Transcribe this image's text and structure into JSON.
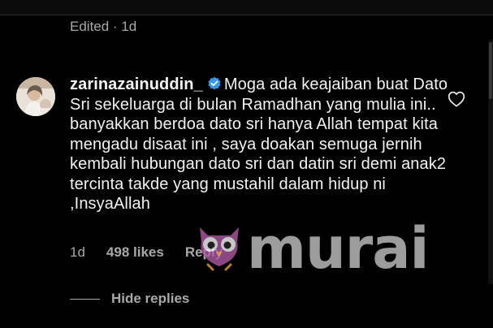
{
  "previous_comment": {
    "meta": "Edited · 1d"
  },
  "comment": {
    "username": "zarinazainuddin_",
    "verified_icon": "verified-badge-icon",
    "text": "Moga ada keajaiban buat Dato Sri sekeluarga di bulan Ramadhan yang mulia ini.. banyakkan berdoa dato sri hanya Allah tempat kita mengadu disaat ini , saya doakan semuga jernih kembali hubungan dato sri dan datin sri demi anak2 tercinta takde yang mustahil dalam hidup ni ,InsyaAllah",
    "time": "1d",
    "likes": "498 likes",
    "reply_label": "Reply",
    "like_icon": "heart-outline-icon"
  },
  "replies": {
    "toggle_label": "Hide replies"
  },
  "watermark": {
    "text": "murai",
    "icon": "owl-mascot-icon"
  },
  "colors": {
    "background": "#000000",
    "primary_text": "#f2f2f2",
    "secondary_text": "#a8a8a8",
    "verified": "#3897f0"
  }
}
